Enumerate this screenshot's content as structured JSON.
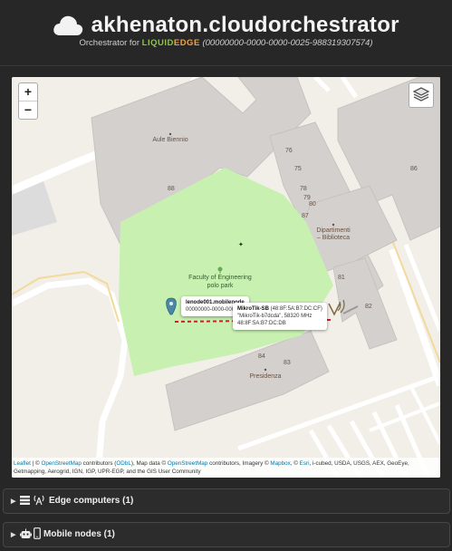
{
  "header": {
    "title": "akhenaton.cloudorchestrator",
    "subtitle_prefix": "Orchestrator for",
    "brand_part1": "LIQUID",
    "brand_part2": "EDGE",
    "uuid": "(00000000-0000-0000-0025-988319307574)"
  },
  "map": {
    "zoom_in": "+",
    "zoom_out": "−",
    "labels": {
      "aule_biennio": "Aule Biennio",
      "dipartimenti": "Dipartimenti\n– Biblioteca",
      "faculty_park": "Faculty of Engineering\npolo park",
      "presidenza": "Presidenza"
    },
    "building_numbers": [
      "88",
      "76",
      "75",
      "78",
      "79",
      "80",
      "87",
      "86",
      "81",
      "84",
      "82",
      "83"
    ],
    "popup_node": {
      "title": "lenode001.mobilenode",
      "line2": "00000000-0000-0000"
    },
    "popup_wifi": {
      "name": "MikroTik-SB",
      "mac_paren": "(48:8F:5A:B7:DC:CF)",
      "line2": "\"MikroTik-b7dcda\", 58320 MHz",
      "line3": "48:8F:5A:B7:DC:DB"
    },
    "attribution": {
      "leaflet": "Leaflet",
      "osm": "OpenStreetMap",
      "contributors": "contributors (",
      "odbl": "ODbL",
      "mapdata": "), Map data ©",
      "osm2": "OpenStreetMap",
      "imagery": "contributors, Imagery ©",
      "mapbox": "Mapbox",
      "copy": ", ©",
      "esri": "Esri",
      "rest": ", i-cubed, USDA, USGS, AEX, GeoEye, Getmapping, Aerogrid, IGN, IGP, UPR-EGP, and the GIS User Community"
    }
  },
  "sections": {
    "edge_computers": "Edge computers (1)",
    "mobile_nodes": "Mobile nodes (1)"
  },
  "colors": {
    "background": "#272727",
    "brand_green": "#8cc63f",
    "brand_orange": "#f6a33a",
    "link": "#0078a8",
    "marker": "#4c87a3",
    "dashed_line": "#cc2222"
  }
}
